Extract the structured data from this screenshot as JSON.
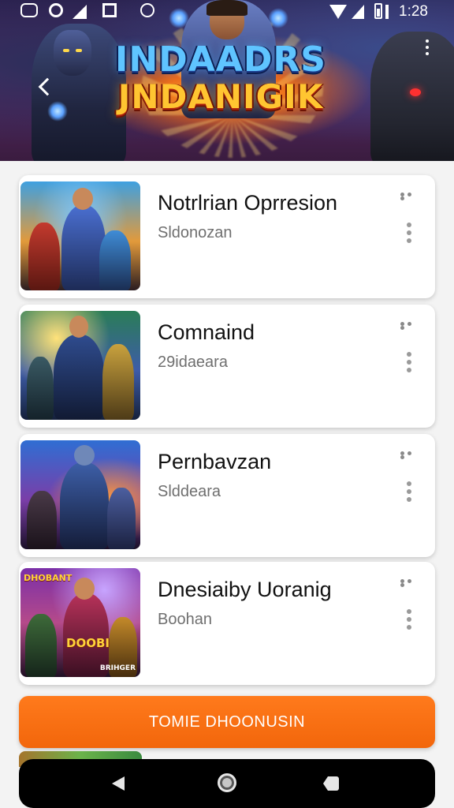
{
  "status_bar": {
    "time": "1:28",
    "icons": [
      "camera-notification-icon",
      "circle-notification-icon",
      "signal-notification-icon",
      "square-notification-icon",
      "clock-notification-icon",
      "wifi-icon",
      "cell-signal-icon",
      "battery-icon"
    ]
  },
  "header": {
    "title_line1": "INDAADRS",
    "title_line2": "JNDANIGIK",
    "back_icon": "back-chevron-icon",
    "more_icon": "overflow-menu-icon"
  },
  "games": [
    {
      "title": "Notrlrian Oprresion",
      "subtitle": "Sldonozan",
      "thumb_badge_top": "",
      "thumb_badge_mid": "",
      "thumb_badge_bot": ""
    },
    {
      "title": "Comnaind",
      "subtitle": "29idaeara",
      "thumb_badge_top": "",
      "thumb_badge_mid": "",
      "thumb_badge_bot": ""
    },
    {
      "title": "Pernbavzan",
      "subtitle": "Slddeara",
      "thumb_badge_top": "",
      "thumb_badge_mid": "",
      "thumb_badge_bot": ""
    },
    {
      "title": "Dnesiaiby Uoranig",
      "subtitle": "Boohan",
      "thumb_badge_top": "DHOBANT",
      "thumb_badge_mid": "DOOBI",
      "thumb_badge_bot": "BRIHGER"
    }
  ],
  "cta": {
    "label": "TOMIE DHOONUSIN"
  },
  "system_nav": {
    "back_icon": "nav-back-triangle-icon",
    "home_icon": "nav-home-circle-icon",
    "recent_icon": "nav-recent-square-icon"
  },
  "colors": {
    "accent": "#f2660b",
    "card_bg": "#ffffff",
    "page_bg": "#f3f3f3",
    "title_text": "#111111",
    "subtitle_text": "#6f6f6f"
  }
}
